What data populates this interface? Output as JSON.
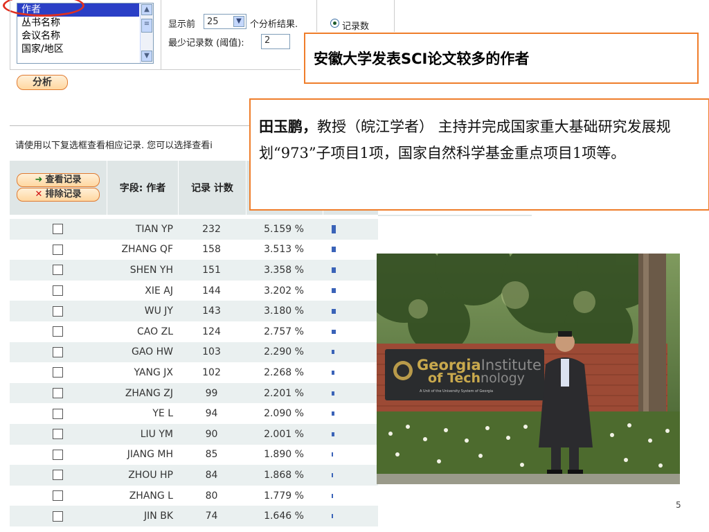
{
  "field_list": {
    "options": [
      "作者",
      "丛书名称",
      "会议名称",
      "国家/地区"
    ],
    "selected_index": 0
  },
  "controls": {
    "show_prefix": "显示前",
    "show_count": "25",
    "show_suffix": "个分析结果.",
    "min_label": "最少记录数 (阈值):",
    "min_value": "2",
    "radio_label": "记录数",
    "analyze_button": "分析"
  },
  "callouts": {
    "title": "安徽大学发表SCI论文较多的作者",
    "bio_name": "田玉鹏，",
    "bio_text": "教授（皖江学者） 主持并完成国家重大基础研究发展规划“973”子项目1项，国家自然科学基金重点项目1项等。"
  },
  "instruction": "请使用以下复选框查看相应记录. 您可以选择查看i",
  "table": {
    "view_button": "查看记录",
    "exclude_button": "排除记录",
    "col_field": "字段: 作者",
    "col_count": "记录 计数",
    "rows": [
      {
        "author": "TIAN YP",
        "count": "232",
        "pct": "5.159 %",
        "value": 232
      },
      {
        "author": "ZHANG QF",
        "count": "158",
        "pct": "3.513 %",
        "value": 158
      },
      {
        "author": "SHEN YH",
        "count": "151",
        "pct": "3.358 %",
        "value": 151
      },
      {
        "author": "XIE AJ",
        "count": "144",
        "pct": "3.202 %",
        "value": 144
      },
      {
        "author": "WU JY",
        "count": "143",
        "pct": "3.180 %",
        "value": 143
      },
      {
        "author": "CAO ZL",
        "count": "124",
        "pct": "2.757 %",
        "value": 124
      },
      {
        "author": "GAO HW",
        "count": "103",
        "pct": "2.290 %",
        "value": 103
      },
      {
        "author": "YANG JX",
        "count": "102",
        "pct": "2.268 %",
        "value": 102
      },
      {
        "author": "ZHANG ZJ",
        "count": "99",
        "pct": "2.201 %",
        "value": 99
      },
      {
        "author": "YE L",
        "count": "94",
        "pct": "2.090 %",
        "value": 94
      },
      {
        "author": "LIU YM",
        "count": "90",
        "pct": "2.001 %",
        "value": 90
      },
      {
        "author": "JIANG MH",
        "count": "85",
        "pct": "1.890 %",
        "value": 85
      },
      {
        "author": "ZHOU HP",
        "count": "84",
        "pct": "1.868 %",
        "value": 84
      },
      {
        "author": "ZHANG L",
        "count": "80",
        "pct": "1.779 %",
        "value": 80
      },
      {
        "author": "JIN BK",
        "count": "74",
        "pct": "1.646 %",
        "value": 74
      }
    ]
  },
  "photo": {
    "sign_line1a": "Georgia",
    "sign_line1b": "Institute",
    "sign_line2a": "of Tech",
    "sign_line2b": "nology",
    "sign_small": "A Unit of the University System of Georgia"
  },
  "page_number": "5",
  "colors": {
    "accent": "#ef7d2a",
    "bar": "#3a63b8",
    "selected": "#2a3fc6"
  }
}
